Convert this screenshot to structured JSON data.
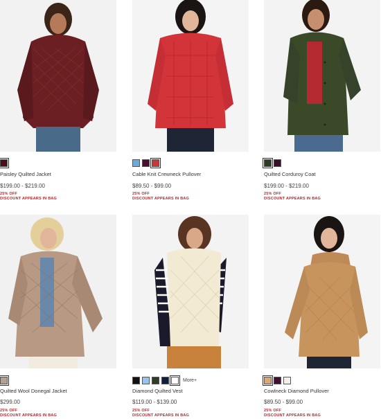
{
  "products": [
    {
      "name": "Paisley Quilted Jacket",
      "price": "$199.00 - $219.00",
      "promo_percent": "25% OFF",
      "promo_note": "DISCOUNT APPEARS IN BAG",
      "swatches": [
        "#4a0f1a"
      ],
      "more": ""
    },
    {
      "name": "Cable Knit Crewneck Pullover",
      "price": "$89.50 - $99.00",
      "promo_percent": "25% OFF",
      "promo_note": "DISCOUNT APPEARS IN BAG",
      "swatches": [
        "#6ea9dc",
        "#4a1030",
        "#c8373a"
      ],
      "more": ""
    },
    {
      "name": "Quilted Corduroy Coat",
      "price": "$199.00 - $219.00",
      "promo_percent": "25% OFF",
      "promo_note": "DISCOUNT APPEARS IN BAG",
      "swatches": [
        "#2c3b22",
        "#3a0f28"
      ],
      "more": ""
    },
    {
      "name": "Quilted Wool Donegal Jacket",
      "price": "$299.00",
      "promo_percent": "25% OFF",
      "promo_note": "DISCOUNT APPEARS IN BAG",
      "swatches": [
        "#b8a08f"
      ],
      "more": ""
    },
    {
      "name": "Diamond Quilted Vest",
      "price": "$119.00 - $139.00",
      "promo_percent": "25% OFF",
      "promo_note": "DISCOUNT APPEARS IN BAG",
      "swatches": [
        "#111111",
        "#9bc3ea",
        "#2f3d28",
        "#0d1f3c",
        "#ffffff"
      ],
      "more": "More+"
    },
    {
      "name": "Cowlneck Diamond Pullover",
      "price": "$89.50 - $99.00",
      "promo_percent": "25% OFF",
      "promo_note": "DISCOUNT APPEARS IN BAG",
      "swatches": [
        "#d8a878",
        "#3f1030",
        "#f4efe8"
      ],
      "more": ""
    }
  ]
}
